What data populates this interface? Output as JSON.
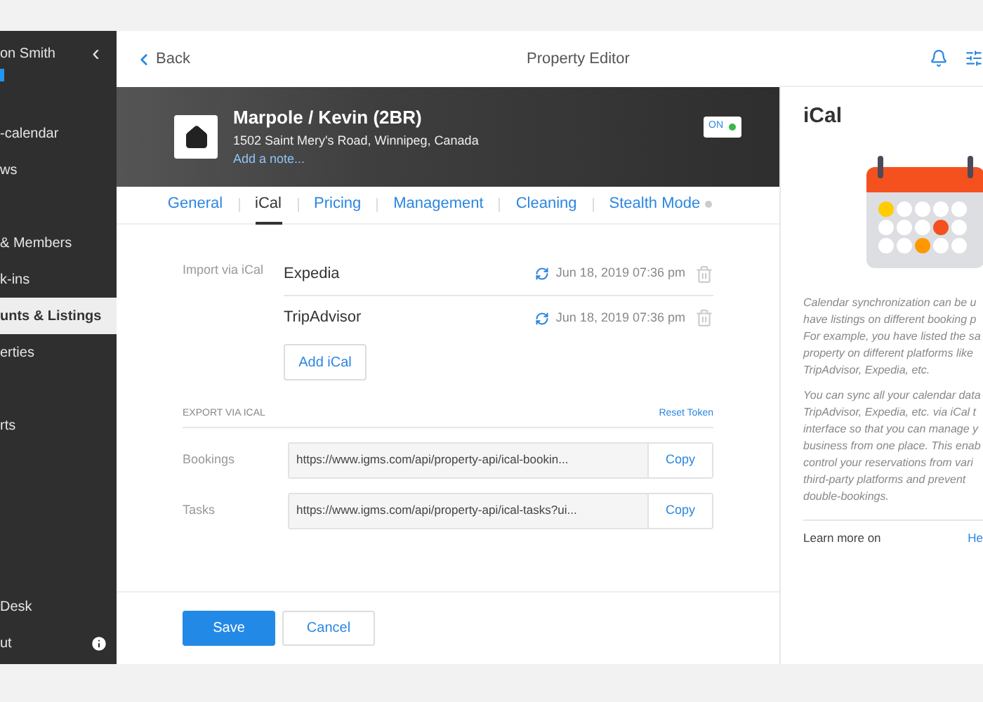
{
  "sidebar": {
    "user_name": "on Smith",
    "collapse_icon": "‹",
    "items": [
      {
        "label": "-calendar",
        "selected": false
      },
      {
        "label": "ws",
        "selected": false
      },
      {
        "label": "& Members",
        "selected": false
      },
      {
        "label": "k-ins",
        "selected": false
      },
      {
        "label": "unts & Listings",
        "selected": true
      },
      {
        "label": "erties",
        "selected": false
      },
      {
        "label": "rts",
        "selected": false
      }
    ],
    "bottom_items": [
      {
        "label": "Desk",
        "info": false
      },
      {
        "label": "ut",
        "info": true
      }
    ]
  },
  "top_bar": {
    "back": "Back",
    "title": "Property Editor"
  },
  "property": {
    "name": "Marpole / Kevin (2BR)",
    "address": "1502 Saint Mery's Road, Winnipeg, Canada",
    "note_link": "Add a note...",
    "status": {
      "label": "ON",
      "on": true
    }
  },
  "tabs": [
    {
      "label": "General",
      "selected": false
    },
    {
      "label": "iCal",
      "selected": true
    },
    {
      "label": "Pricing",
      "selected": false
    },
    {
      "label": "Management",
      "selected": false
    },
    {
      "label": "Cleaning",
      "selected": false
    },
    {
      "label": "Stealth Mode",
      "selected": false,
      "dot": true
    }
  ],
  "import": {
    "label": "Import via iCal",
    "feeds": [
      {
        "name": "Expedia",
        "synced": "Jun 18, 2019 07:36 pm"
      },
      {
        "name": "TripAdvisor",
        "synced": "Jun 18, 2019 07:36 pm"
      }
    ],
    "add_button": "Add iCal"
  },
  "export": {
    "heading": "EXPORT VIA ICAL",
    "reset_link": "Reset Token",
    "rows": [
      {
        "label": "Bookings",
        "url": "https://www.igms.com/api/property-api/ical-bookin...",
        "copy": "Copy"
      },
      {
        "label": "Tasks",
        "url": "https://www.igms.com/api/property-api/ical-tasks?ui...",
        "copy": "Copy"
      }
    ]
  },
  "footer": {
    "save": "Save",
    "cancel": "Cancel"
  },
  "help_panel": {
    "title": "iCal",
    "paragraphs": [
      [
        "Calendar synchronization can be u",
        "have listings on different booking p",
        "For example, you have listed the sa",
        "property on different platforms like",
        "TripAdvisor, Expedia, etc."
      ],
      [
        "You can sync all your calendar data",
        "TripAdvisor, Expedia, etc. via iCal t",
        "interface so that you can manage y",
        "business from one place. This enab",
        "control your reservations from vari",
        "third-party platforms and prevent",
        "double-bookings."
      ]
    ],
    "learn_more": "Learn more on",
    "link": "He"
  }
}
